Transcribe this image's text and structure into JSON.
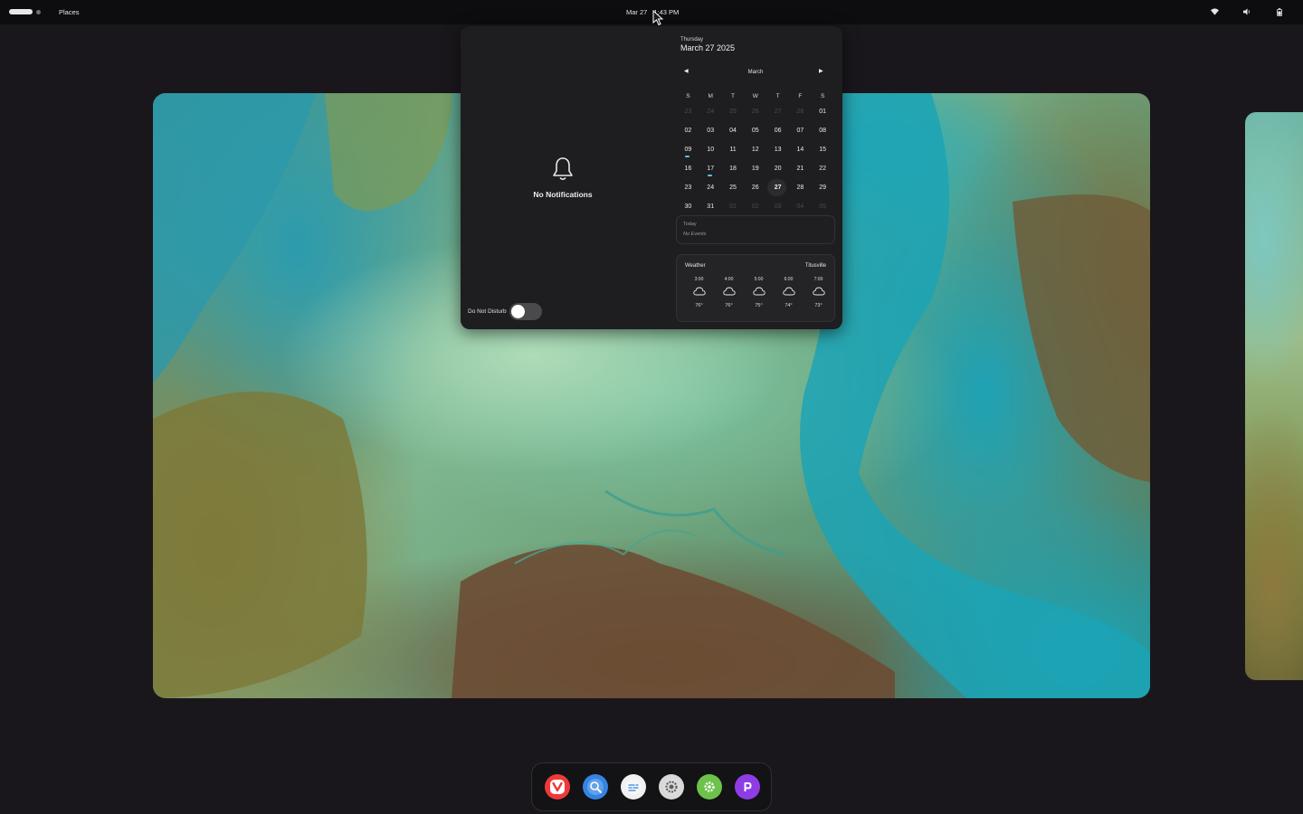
{
  "topbar": {
    "places_label": "Places",
    "date": "Mar 27",
    "time": "1:43 PM",
    "tray_icons": [
      "wifi-icon",
      "volume-icon",
      "battery-icon"
    ]
  },
  "notifications": {
    "empty_label": "No Notifications",
    "dnd_label": "Do Not Disturb",
    "dnd_enabled": false
  },
  "calendar": {
    "weekday": "Thursday",
    "full_date": "March 27 2025",
    "month": "March",
    "day_headers": [
      "S",
      "M",
      "T",
      "W",
      "T",
      "F",
      "S"
    ],
    "weeks": [
      [
        {
          "d": "23",
          "dim": true
        },
        {
          "d": "24",
          "dim": true
        },
        {
          "d": "25",
          "dim": true
        },
        {
          "d": "26",
          "dim": true
        },
        {
          "d": "27",
          "dim": true
        },
        {
          "d": "28",
          "dim": true
        },
        {
          "d": "01"
        }
      ],
      [
        {
          "d": "02"
        },
        {
          "d": "03"
        },
        {
          "d": "04"
        },
        {
          "d": "05"
        },
        {
          "d": "06"
        },
        {
          "d": "07"
        },
        {
          "d": "08"
        }
      ],
      [
        {
          "d": "09",
          "event": true
        },
        {
          "d": "10"
        },
        {
          "d": "11"
        },
        {
          "d": "12"
        },
        {
          "d": "13"
        },
        {
          "d": "14"
        },
        {
          "d": "15"
        }
      ],
      [
        {
          "d": "16"
        },
        {
          "d": "17",
          "event": true
        },
        {
          "d": "18"
        },
        {
          "d": "19"
        },
        {
          "d": "20"
        },
        {
          "d": "21"
        },
        {
          "d": "22"
        }
      ],
      [
        {
          "d": "23"
        },
        {
          "d": "24"
        },
        {
          "d": "25"
        },
        {
          "d": "26"
        },
        {
          "d": "27",
          "today": true
        },
        {
          "d": "28"
        },
        {
          "d": "29"
        }
      ],
      [
        {
          "d": "30"
        },
        {
          "d": "31"
        },
        {
          "d": "01",
          "dim": true
        },
        {
          "d": "02",
          "dim": true
        },
        {
          "d": "03",
          "dim": true
        },
        {
          "d": "04",
          "dim": true
        },
        {
          "d": "05",
          "dim": true
        }
      ]
    ],
    "events_heading": "Today",
    "events_empty": "No Events"
  },
  "weather": {
    "title": "Weather",
    "location": "Titusville",
    "forecast": [
      {
        "hour": "3:00",
        "icon": "cloud-icon",
        "temp": "76°"
      },
      {
        "hour": "4:00",
        "icon": "cloud-icon",
        "temp": "76°"
      },
      {
        "hour": "5:00",
        "icon": "cloud-icon",
        "temp": "75°"
      },
      {
        "hour": "6:00",
        "icon": "cloud-icon",
        "temp": "74°"
      },
      {
        "hour": "7:00",
        "icon": "cloud-icon",
        "temp": "73°"
      }
    ]
  },
  "dock": {
    "apps": [
      {
        "name": "vivaldi-icon",
        "color": "#ef3939"
      },
      {
        "name": "web-browser-icon",
        "color": "#3584e4"
      },
      {
        "name": "text-editor-icon",
        "color": "#f0f0f0"
      },
      {
        "name": "settings-icon",
        "color": "#d8d8d8"
      },
      {
        "name": "app-store-icon",
        "color": "#6cc24a"
      },
      {
        "name": "proton-pass-icon",
        "color": "#8e3de6"
      }
    ]
  },
  "colors": {
    "accent": "#57c6e8",
    "panel": "#1e1d1f",
    "topbar": "#0d0c0e"
  }
}
